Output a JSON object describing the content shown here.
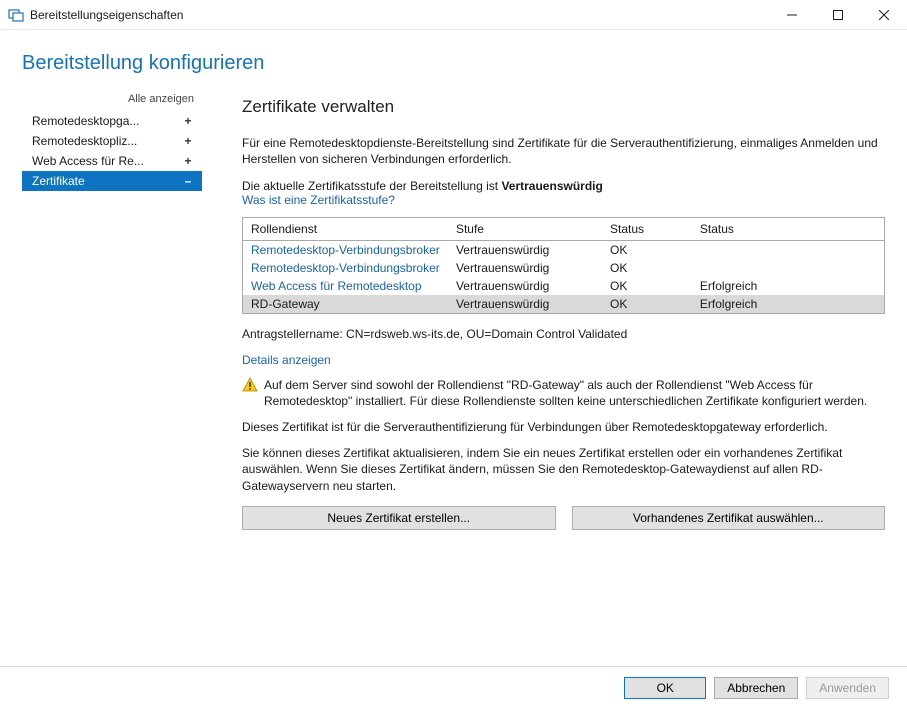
{
  "window": {
    "title": "Bereitstellungseigenschaften"
  },
  "header": "Bereitstellung konfigurieren",
  "sidebar": {
    "show_all": "Alle anzeigen",
    "items": [
      {
        "label": "Remotedesktopga...",
        "expander": "+",
        "selected": false
      },
      {
        "label": "Remotedesktopliz...",
        "expander": "+",
        "selected": false
      },
      {
        "label": "Web Access für Re...",
        "expander": "+",
        "selected": false
      },
      {
        "label": "Zertifikate",
        "expander": "–",
        "selected": true
      }
    ]
  },
  "main": {
    "heading": "Zertifikate verwalten",
    "intro": "Für eine Remotedesktopdienste-Bereitstellung sind Zertifikate für die Serverauthentifizierung, einmaliges Anmelden und Herstellen von sicheren Verbindungen erforderlich.",
    "level_prefix": "Die aktuelle Zertifikatsstufe der Bereitstellung ist ",
    "level_value": "Vertrauenswürdig",
    "level_link": "Was ist eine Zertifikatsstufe?",
    "table": {
      "headers": [
        "Rollendienst",
        "Stufe",
        "Status",
        "Status"
      ],
      "rows": [
        {
          "service": "Remotedesktop-Verbindungsbroker",
          "level": "Vertrauenswürdig",
          "status1": "OK",
          "status2": "",
          "selected": false
        },
        {
          "service": "Remotedesktop-Verbindungsbroker",
          "level": "Vertrauenswürdig",
          "status1": "OK",
          "status2": "",
          "selected": false
        },
        {
          "service": "Web Access für Remotedesktop",
          "level": "Vertrauenswürdig",
          "status1": "OK",
          "status2": "Erfolgreich",
          "selected": false
        },
        {
          "service": "RD-Gateway",
          "level": "Vertrauenswürdig",
          "status1": "OK",
          "status2": "Erfolgreich",
          "selected": true
        }
      ]
    },
    "subject_name": "Antragstellername: CN=rdsweb.ws-its.de, OU=Domain Control Validated",
    "details_link": "Details anzeigen",
    "warning": "Auf dem Server sind sowohl der Rollendienst \"RD-Gateway\" als auch der Rollendienst \"Web Access für Remotedesktop\" installiert. Für diese Rollendienste sollten keine unterschiedlichen Zertifikate konfiguriert werden.",
    "purpose": "Dieses Zertifikat ist für die Serverauthentifizierung für Verbindungen über Remotedesktopgateway erforderlich.",
    "update_info": "Sie können dieses Zertifikat aktualisieren, indem Sie ein neues Zertifikat erstellen oder ein vorhandenes Zertifikat auswählen. Wenn Sie dieses Zertifikat ändern, müssen Sie den Remotedesktop-Gatewaydienst auf allen RD-Gatewayservern neu starten.",
    "btn_new": "Neues Zertifikat erstellen...",
    "btn_existing": "Vorhandenes Zertifikat auswählen..."
  },
  "footer": {
    "ok": "OK",
    "cancel": "Abbrechen",
    "apply": "Anwenden"
  }
}
